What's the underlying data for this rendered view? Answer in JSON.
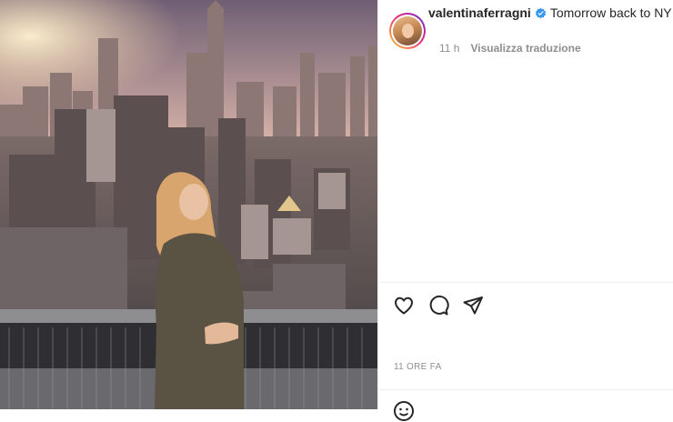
{
  "post": {
    "username": "valentinaferragni",
    "caption": "Tomorrow back to NY",
    "verified": true,
    "time_ago": "11 h",
    "translate_label": "Visualizza traduzione",
    "timestamp": "11 ORE FA"
  },
  "actions": {
    "like": "heart-icon",
    "comment": "comment-icon",
    "share": "share-icon"
  },
  "comment_bar": {
    "emoji_icon": "emoji-icon"
  },
  "colors": {
    "verified_blue": "#3897f0",
    "text": "#262626",
    "muted": "#8e8e8e",
    "divider": "#efefef"
  }
}
